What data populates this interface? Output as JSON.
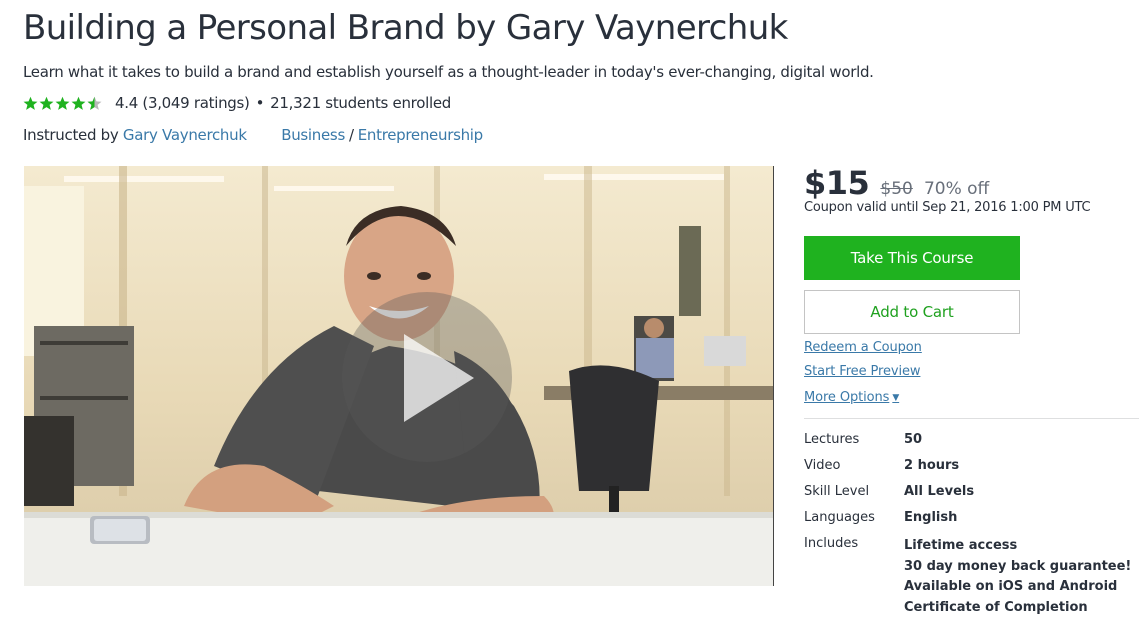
{
  "course": {
    "title": "Building a Personal Brand by Gary Vaynerchuk",
    "subtitle": "Learn what it takes to build a brand and establish yourself as a thought-leader in today's ever-changing, digital world.",
    "rating_value": 4.4,
    "rating_text": "4.4 (3,049 ratings)",
    "separator": "•",
    "students": "21,321 students enrolled",
    "instructed_by_label": "Instructed by",
    "instructor": "Gary Vaynerchuk",
    "category": "Business",
    "category_separator": "/",
    "subcategory": "Entrepreneurship"
  },
  "pricing": {
    "price": "$15",
    "original_price": "$50",
    "discount": "70% off",
    "coupon_text": "Coupon valid until Sep 21, 2016 1:00 PM UTC"
  },
  "actions": {
    "take_course": "Take This Course",
    "add_to_cart": "Add to Cart",
    "redeem_coupon": "Redeem a Coupon",
    "free_preview": "Start Free Preview",
    "more_options": "More Options"
  },
  "details": [
    {
      "label": "Lectures",
      "values": [
        "50"
      ]
    },
    {
      "label": "Video",
      "values": [
        "2 hours"
      ]
    },
    {
      "label": "Skill Level",
      "values": [
        "All Levels"
      ]
    },
    {
      "label": "Languages",
      "values": [
        "English"
      ]
    },
    {
      "label": "Includes",
      "values": [
        "Lifetime access",
        "30 day money back guarantee!",
        "Available on iOS and Android",
        "Certificate of Completion"
      ]
    }
  ],
  "colors": {
    "accent_green": "#1fb21f",
    "link_blue": "#3a79a8",
    "star_green": "#1fb21f"
  }
}
